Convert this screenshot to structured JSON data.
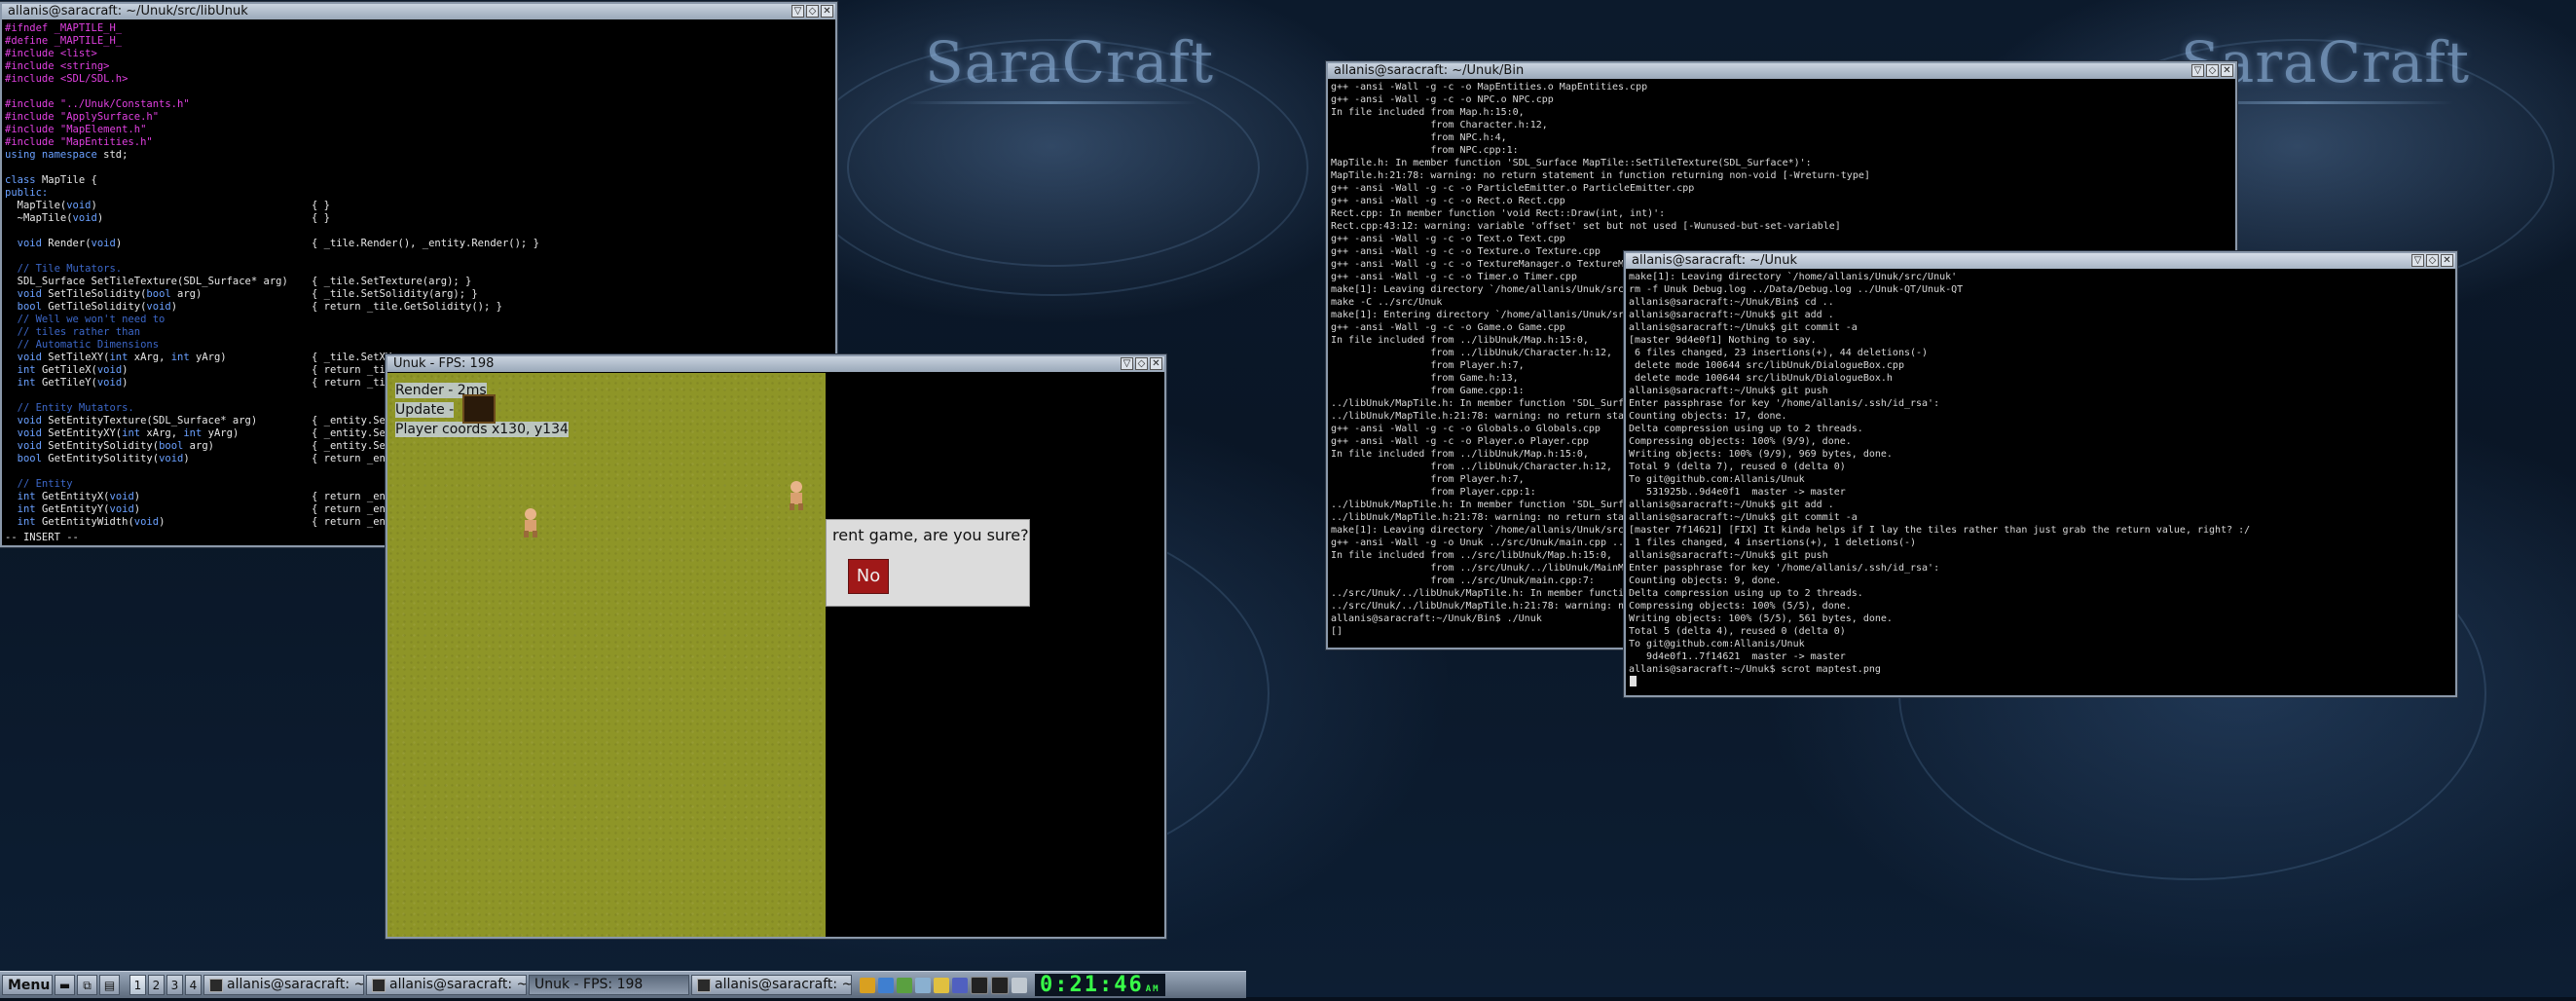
{
  "brand": {
    "text": "SaraCraft"
  },
  "vim_window": {
    "title": "allanis@saracraft: ~/Unuk/src/libUnuk",
    "mode": "-- INSERT --",
    "lines": [
      [
        {
          "c": "pp",
          "t": "#ifndef _MAPTILE_H_"
        }
      ],
      [
        {
          "c": "pp",
          "t": "#define _MAPTILE_H_"
        }
      ],
      [
        {
          "c": "pp",
          "t": "#include <list>"
        }
      ],
      [
        {
          "c": "pp",
          "t": "#include <string>"
        }
      ],
      [
        {
          "c": "pp",
          "t": "#include <SDL/SDL.h>"
        }
      ],
      [],
      [
        {
          "c": "pp",
          "t": "#include \"../Unuk/Constants.h\""
        }
      ],
      [
        {
          "c": "pp",
          "t": "#include \"ApplySurface.h\""
        }
      ],
      [
        {
          "c": "pp",
          "t": "#include \"MapElement.h\""
        }
      ],
      [
        {
          "c": "pp",
          "t": "#include \"MapEntities.h\""
        }
      ],
      [
        {
          "c": "kw",
          "t": "using namespace "
        },
        {
          "c": "tx",
          "t": "std;"
        }
      ],
      [],
      [
        {
          "c": "kw",
          "t": "class "
        },
        {
          "c": "tx",
          "t": "MapTile {"
        }
      ],
      [
        {
          "c": "kw",
          "t": "public:"
        }
      ],
      [
        {
          "c": "tx",
          "t": "  MapTile("
        },
        {
          "c": "kw",
          "t": "void"
        },
        {
          "c": "tx",
          "t": ")"
        }
      ],
      [
        {
          "c": "tx",
          "t": "  ~MapTile("
        },
        {
          "c": "kw",
          "t": "void"
        },
        {
          "c": "tx",
          "t": ")"
        }
      ],
      [],
      [
        {
          "c": "tx",
          "t": "  "
        },
        {
          "c": "kw",
          "t": "void "
        },
        {
          "c": "tx",
          "t": "Render("
        },
        {
          "c": "kw",
          "t": "void"
        },
        {
          "c": "tx",
          "t": ")"
        }
      ],
      [],
      [
        {
          "c": "cm",
          "t": "  // Tile Mutators."
        }
      ],
      [
        {
          "c": "tx",
          "t": "  SDL_Surface SetTileTexture(SDL_Surface* arg)"
        }
      ],
      [
        {
          "c": "tx",
          "t": "  "
        },
        {
          "c": "kw",
          "t": "void "
        },
        {
          "c": "tx",
          "t": "SetTileSolidity("
        },
        {
          "c": "kw",
          "t": "bool "
        },
        {
          "c": "tx",
          "t": "arg)"
        }
      ],
      [
        {
          "c": "tx",
          "t": "  "
        },
        {
          "c": "kw",
          "t": "bool "
        },
        {
          "c": "tx",
          "t": "GetTileSolidity("
        },
        {
          "c": "kw",
          "t": "void"
        },
        {
          "c": "tx",
          "t": ")"
        }
      ],
      [
        {
          "c": "cm",
          "t": "  // Well we won't need to"
        }
      ],
      [
        {
          "c": "cm",
          "t": "  // tiles rather than"
        }
      ],
      [
        {
          "c": "cm",
          "t": "  // Automatic Dimensions"
        }
      ],
      [
        {
          "c": "tx",
          "t": "  "
        },
        {
          "c": "kw",
          "t": "void "
        },
        {
          "c": "tx",
          "t": "SetTileXY("
        },
        {
          "c": "kw",
          "t": "int "
        },
        {
          "c": "tx",
          "t": "xArg, "
        },
        {
          "c": "kw",
          "t": "int "
        },
        {
          "c": "tx",
          "t": "yArg)"
        }
      ],
      [
        {
          "c": "tx",
          "t": "  "
        },
        {
          "c": "kw",
          "t": "int "
        },
        {
          "c": "tx",
          "t": "GetTileX("
        },
        {
          "c": "kw",
          "t": "void"
        },
        {
          "c": "tx",
          "t": ")"
        }
      ],
      [
        {
          "c": "tx",
          "t": "  "
        },
        {
          "c": "kw",
          "t": "int "
        },
        {
          "c": "tx",
          "t": "GetTileY("
        },
        {
          "c": "kw",
          "t": "void"
        },
        {
          "c": "tx",
          "t": ")"
        }
      ],
      [],
      [
        {
          "c": "cm",
          "t": "  // Entity Mutators."
        }
      ],
      [
        {
          "c": "tx",
          "t": "  "
        },
        {
          "c": "kw",
          "t": "void "
        },
        {
          "c": "tx",
          "t": "SetEntityTexture(SDL_Surface* arg)"
        }
      ],
      [
        {
          "c": "tx",
          "t": "  "
        },
        {
          "c": "kw",
          "t": "void "
        },
        {
          "c": "tx",
          "t": "SetEntityXY("
        },
        {
          "c": "kw",
          "t": "int "
        },
        {
          "c": "tx",
          "t": "xArg, "
        },
        {
          "c": "kw",
          "t": "int "
        },
        {
          "c": "tx",
          "t": "yArg)"
        }
      ],
      [
        {
          "c": "tx",
          "t": "  "
        },
        {
          "c": "kw",
          "t": "void "
        },
        {
          "c": "tx",
          "t": "SetEntitySolidity("
        },
        {
          "c": "kw",
          "t": "bool "
        },
        {
          "c": "tx",
          "t": "arg)"
        }
      ],
      [
        {
          "c": "tx",
          "t": "  "
        },
        {
          "c": "kw",
          "t": "bool "
        },
        {
          "c": "tx",
          "t": "GetEntitySolitity("
        },
        {
          "c": "kw",
          "t": "void"
        },
        {
          "c": "tx",
          "t": ")"
        }
      ],
      [],
      [
        {
          "c": "cm",
          "t": "  // Entity"
        }
      ],
      [
        {
          "c": "tx",
          "t": "  "
        },
        {
          "c": "kw",
          "t": "int "
        },
        {
          "c": "tx",
          "t": "GetEntityX("
        },
        {
          "c": "kw",
          "t": "void"
        },
        {
          "c": "tx",
          "t": ")"
        }
      ],
      [
        {
          "c": "tx",
          "t": "  "
        },
        {
          "c": "kw",
          "t": "int "
        },
        {
          "c": "tx",
          "t": "GetEntityY("
        },
        {
          "c": "kw",
          "t": "void"
        },
        {
          "c": "tx",
          "t": ")"
        }
      ],
      [
        {
          "c": "tx",
          "t": "  "
        },
        {
          "c": "kw",
          "t": "int "
        },
        {
          "c": "tx",
          "t": "GetEntityWidth("
        },
        {
          "c": "kw",
          "t": "void"
        },
        {
          "c": "tx",
          "t": ")"
        }
      ]
    ],
    "right_col": [
      {
        "row": 14,
        "t": "{ }"
      },
      {
        "row": 15,
        "t": "{ }"
      },
      {
        "row": 17,
        "t": "{ _tile.Render(), _entity.Render(); }"
      },
      {
        "row": 20,
        "t": "{ _tile.SetTexture(arg); }"
      },
      {
        "row": 21,
        "t": "{ _tile.SetSolidity(arg); }"
      },
      {
        "row": 22,
        "t": "{ return _tile.GetSolidity(); }"
      },
      {
        "row": 26,
        "t": "{ _tile.SetXY"
      },
      {
        "row": 27,
        "t": "{ return _til"
      },
      {
        "row": 28,
        "t": "{ return _til"
      },
      {
        "row": 31,
        "t": "{ _entity.Set"
      },
      {
        "row": 32,
        "t": "{ _entity.Set"
      },
      {
        "row": 33,
        "t": "{ _entity.Set"
      },
      {
        "row": 34,
        "t": "{ return _ent"
      },
      {
        "row": 37,
        "t": "{ return _ent"
      },
      {
        "row": 38,
        "t": "{ return _ent"
      },
      {
        "row": 39,
        "t": "{ return _ent"
      }
    ]
  },
  "game_window": {
    "title": "Unuk - FPS: 198",
    "hud": {
      "render": "Render - 2ms",
      "update": "Update -",
      "coords": "Player coords x130, y134"
    },
    "dialog": {
      "text": "rent game, are you sure?",
      "no_button": "No"
    }
  },
  "bin_window": {
    "title": "allanis@saracraft: ~/Unuk/Bin",
    "lines": [
      "g++ -ansi -Wall -g -c -o MapEntities.o MapEntities.cpp",
      "g++ -ansi -Wall -g -c -o NPC.o NPC.cpp",
      "In file included from Map.h:15:0,",
      "                 from Character.h:12,",
      "                 from NPC.h:4,",
      "                 from NPC.cpp:1:",
      "MapTile.h: In member function 'SDL_Surface MapTile::SetTileTexture(SDL_Surface*)':",
      "MapTile.h:21:78: warning: no return statement in function returning non-void [-Wreturn-type]",
      "g++ -ansi -Wall -g -c -o ParticleEmitter.o ParticleEmitter.cpp",
      "g++ -ansi -Wall -g -c -o Rect.o Rect.cpp",
      "Rect.cpp: In member function 'void Rect::Draw(int, int)':",
      "Rect.cpp:43:12: warning: variable 'offset' set but not used [-Wunused-but-set-variable]",
      "g++ -ansi -Wall -g -c -o Text.o Text.cpp",
      "g++ -ansi -Wall -g -c -o Texture.o Texture.cpp",
      "g++ -ansi -Wall -g -c -o TextureManager.o TextureM",
      "g++ -ansi -Wall -g -c -o Timer.o Timer.cpp",
      "make[1]: Leaving directory `/home/allanis/Unuk/src",
      "make -C ../src/Unuk",
      "make[1]: Entering directory `/home/allanis/Unuk/src",
      "g++ -ansi -Wall -g -c -o Game.o Game.cpp",
      "In file included from ../libUnuk/Map.h:15:0,",
      "                 from ../libUnuk/Character.h:12,",
      "                 from Player.h:7,",
      "                 from Game.h:13,",
      "                 from Game.cpp:1:",
      "../libUnuk/MapTile.h: In member function 'SDL_Surfa",
      "../libUnuk/MapTile.h:21:78: warning: no return sta",
      "g++ -ansi -Wall -g -c -o Globals.o Globals.cpp",
      "g++ -ansi -Wall -g -c -o Player.o Player.cpp",
      "In file included from ../libUnuk/Map.h:15:0,",
      "                 from ../libUnuk/Character.h:12,",
      "                 from Player.h:7,",
      "                 from Player.cpp:1:",
      "../libUnuk/MapTile.h: In member function 'SDL_Surfa",
      "../libUnuk/MapTile.h:21:78: warning: no return sta",
      "make[1]: Leaving directory `/home/allanis/Unuk/src",
      "g++ -ansi -Wall -g -o Unuk ../src/Unuk/main.cpp ..",
      "In file included from ../src/libUnuk/Map.h:15:0,",
      "                 from ../src/Unuk/../libUnuk/MainM",
      "                 from ../src/Unuk/main.cpp:7:",
      "../src/Unuk/../libUnuk/MapTile.h: In member functio",
      "../src/Unuk/../libUnuk/MapTile.h:21:78: warning: no",
      "allanis@saracraft:~/Unuk/Bin$ ./Unuk",
      "[]"
    ]
  },
  "unuk_window": {
    "title": "allanis@saracraft: ~/Unuk",
    "lines": [
      "make[1]: Leaving directory `/home/allanis/Unuk/src/Unuk'",
      "rm -f Unuk Debug.log ../Data/Debug.log ../Unuk-QT/Unuk-QT",
      "allanis@saracraft:~/Unuk/Bin$ cd ..",
      "allanis@saracraft:~/Unuk$ git add .",
      "allanis@saracraft:~/Unuk$ git commit -a",
      "[master 9d4e0f1] Nothing to say.",
      " 6 files changed, 23 insertions(+), 44 deletions(-)",
      " delete mode 100644 src/libUnuk/DialogueBox.cpp",
      " delete mode 100644 src/libUnuk/DialogueBox.h",
      "allanis@saracraft:~/Unuk$ git push",
      "Enter passphrase for key '/home/allanis/.ssh/id_rsa':",
      "Counting objects: 17, done.",
      "Delta compression using up to 2 threads.",
      "Compressing objects: 100% (9/9), done.",
      "Writing objects: 100% (9/9), 969 bytes, done.",
      "Total 9 (delta 7), reused 0 (delta 0)",
      "To git@github.com:Allanis/Unuk",
      "   531925b..9d4e0f1  master -> master",
      "allanis@saracraft:~/Unuk$ git add .",
      "allanis@saracraft:~/Unuk$ git commit -a",
      "[master 7f14621] [FIX] It kinda helps if I lay the tiles rather than just grab the return value, right? :/",
      " 1 files changed, 4 insertions(+), 1 deletions(-)",
      "allanis@saracraft:~/Unuk$ git push",
      "Enter passphrase for key '/home/allanis/.ssh/id_rsa':",
      "Counting objects: 9, done.",
      "Delta compression using up to 2 threads.",
      "Compressing objects: 100% (5/5), done.",
      "Writing objects: 100% (5/5), 561 bytes, done.",
      "Total 5 (delta 4), reused 0 (delta 0)",
      "To git@github.com:Allanis/Unuk",
      "   9d4e0f1..7f14621  master -> master",
      "allanis@saracraft:~/Unuk$ scrot maptest.png"
    ]
  },
  "taskbar": {
    "menu": "Menu",
    "desktops": [
      "1",
      "2",
      "3",
      "4"
    ],
    "tasks": [
      "allanis@saracraft: ~/U...",
      "allanis@saracraft: ~/U...",
      "Unuk - FPS: 198",
      "allanis@saracraft: ~/U..."
    ],
    "clock": "0:21:46",
    "clock_ampm": "AM"
  },
  "colors": {
    "clock": "#38ff48",
    "dialog_button": "#a01818",
    "grass": "#8e9527"
  }
}
